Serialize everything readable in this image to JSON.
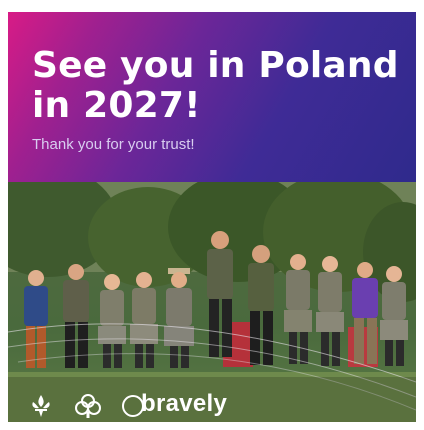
{
  "header": {
    "headline_line1": "See you in Poland",
    "headline_line2": "in 2027!",
    "subtitle": "Thank you for your trust!"
  },
  "footer": {
    "brand": "bravely",
    "logos": [
      "fleur-de-lis-icon",
      "trefoil-icon",
      "circle-icon"
    ]
  },
  "colors": {
    "gradient_start": "#d81b86",
    "gradient_end": "#2f2a8c",
    "text": "#ffffff",
    "subtitle": "#d9cdf0"
  }
}
